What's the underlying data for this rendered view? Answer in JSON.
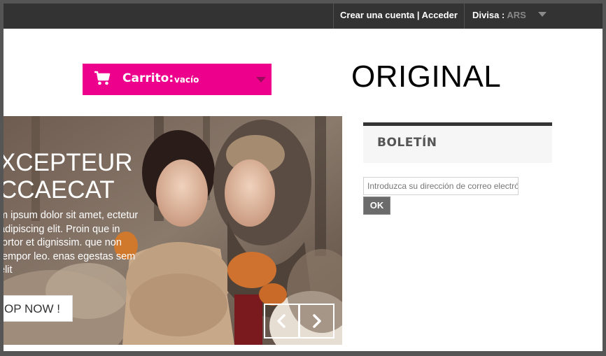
{
  "header": {
    "account_link": "Crear una cuenta | Acceder",
    "currency_label": "Divisa :",
    "currency_value": "ARS"
  },
  "cart": {
    "label": "Carrito:",
    "quantity": "vacío",
    "icon": "shopping-cart-icon"
  },
  "overlay_label": "ORIGINAL",
  "slider": {
    "title": "XCEPTEUR\nCCAECAT",
    "body": "m ipsum dolor sit amet, ectetur adipiscing elit. Proin que in tortor et dignissim. que non tempor leo. enas egestas sem elit",
    "button_label": "OP NOW !",
    "prev_icon": "chevron-left-icon",
    "next_icon": "chevron-right-icon"
  },
  "newsletter": {
    "title": "BOLETÍN",
    "placeholder": "Introduzca su dirección de correo electrónico",
    "submit_label": "OK"
  }
}
